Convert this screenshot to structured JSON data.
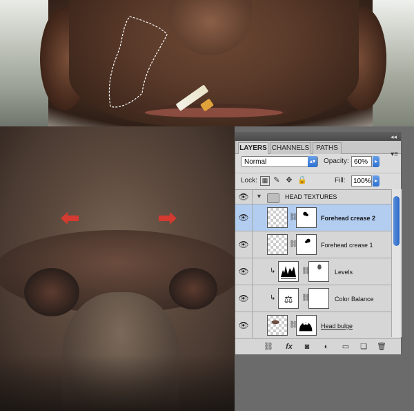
{
  "panel": {
    "tabs": [
      "LAYERS",
      "CHANNELS",
      "PATHS"
    ],
    "blend_mode": "Normal",
    "opacity_label": "Opacity:",
    "opacity_value": "60%",
    "lock_label": "Lock:",
    "fill_label": "Fill:",
    "fill_value": "100%"
  },
  "layers": [
    {
      "name": "HEAD TEXTURES",
      "type": "group"
    },
    {
      "name": "Forehead crease 2",
      "type": "pixel",
      "selected": true
    },
    {
      "name": "Forehead crease 1",
      "type": "pixel"
    },
    {
      "name": "Levels",
      "type": "adjustment",
      "icon": "levels-icon"
    },
    {
      "name": "Color Balance",
      "type": "adjustment",
      "icon": "scales-icon"
    },
    {
      "name": "Head bulge",
      "type": "pixel"
    }
  ],
  "colors": {
    "selected_row": "#b3cdf1",
    "scroll_thumb": "#2c68c6",
    "arrow_red": "#d43a2f"
  }
}
